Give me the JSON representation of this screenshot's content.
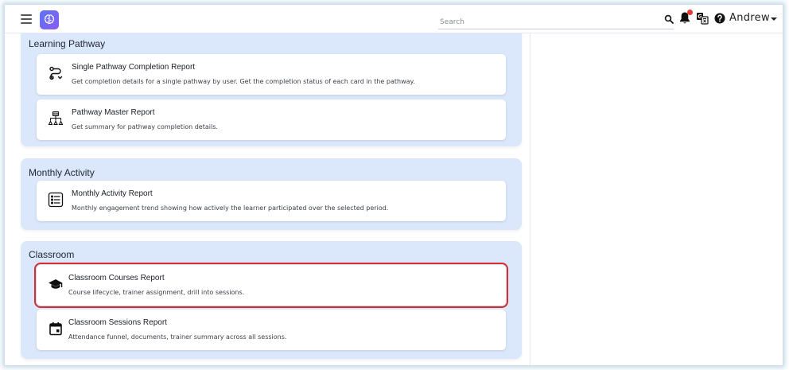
{
  "header": {
    "search_placeholder": "Search",
    "user_name": "Andrew"
  },
  "sections": [
    {
      "title": "Learning Pathway",
      "cards": [
        {
          "title": "Single Pathway Completion Report",
          "description": "Get completion details for a single pathway by user. Get the completion status of each card in the pathway.",
          "icon": "route-icon"
        },
        {
          "title": "Pathway Master Report",
          "description": "Get summary for pathway completion details.",
          "icon": "hierarchy-icon"
        }
      ]
    },
    {
      "title": "Monthly Activity",
      "cards": [
        {
          "title": "Monthly Activity Report",
          "description": "Monthly engagement trend showing how actively the learner participated over the selected period.",
          "icon": "list-icon"
        }
      ]
    },
    {
      "title": "Classroom",
      "cards": [
        {
          "title": "Classroom Courses Report",
          "description": "Course lifecycle, trainer assignment, drill into sessions.",
          "icon": "graduation-cap-icon"
        },
        {
          "title": "Classroom Sessions Report",
          "description": "Attendance funnel, documents, trainer summary across all sessions.",
          "icon": "calendar-icon"
        }
      ]
    }
  ],
  "colors": {
    "section_bg": "#dbe7fb",
    "highlight": "#d32f2f",
    "logo_start": "#5b74f0",
    "logo_end": "#8b5cf6",
    "notification_dot": "#e53935"
  }
}
